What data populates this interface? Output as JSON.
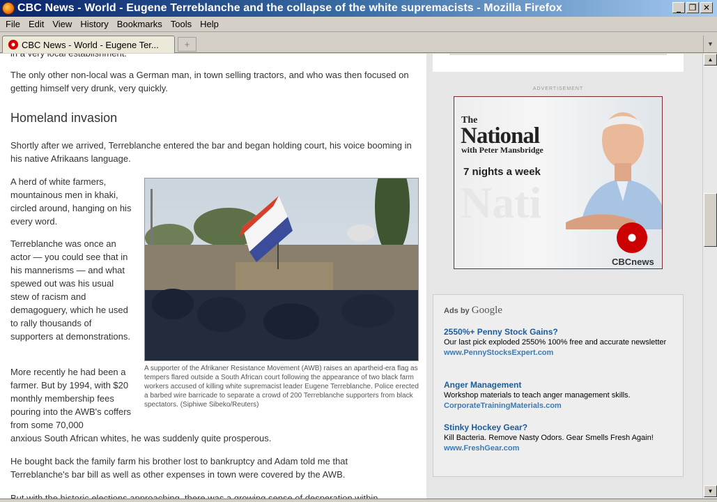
{
  "window": {
    "title": "CBC News - World - Eugene Terreblanche and the collapse of the white supremacists - Mozilla Firefox",
    "minimize": "_",
    "maximize": "❐",
    "close": "✕"
  },
  "menu": [
    "File",
    "Edit",
    "View",
    "History",
    "Bookmarks",
    "Tools",
    "Help"
  ],
  "tab": {
    "label": "CBC News - World - Eugene Ter...",
    "new_tab_icon": "+"
  },
  "article": {
    "cut_top": "in a very local establishment.",
    "p1": "The only other non-local was a German man, in town selling tractors, and who was then focused on getting himself very drunk, very quickly.",
    "subhead": "Homeland invasion",
    "p2": "Shortly after we arrived, Terreblanche entered the bar and began holding court, his voice booming in his native Afrikaans language.",
    "p3": "A herd of white farmers, mountainous men in khaki, circled around, hanging on his every word.",
    "p4": "Terreblanche was once an actor — you could see that in his mannerisms — and what spewed out was his usual stew of racism and demagoguery, which he used to rally thousands of supporters at demonstrations.",
    "p5a": "More recently he had been a farmer. But by 1994, with $20 monthly membership fees pouring into the AWB's coffers from some 70,000",
    "p5b": "anxious South African whites, he was suddenly quite prosperous.",
    "p6": "He bought back the family farm his brother lost to bankruptcy and Adam told me that Terreblanche's bar bill as well as other expenses in town were covered by the AWB.",
    "p7": "But with the historic elections approaching, there was a growing sense of desperation within",
    "photo_caption": "A supporter of the Afrikaner Resistance Movement (AWB) raises an apartheid-era flag as tempers flared outside a South African court following the appearance of two black farm workers accused of killing white supremacist leader Eugene Terreblanche. Police erected a barbed wire barricade to separate a crowd of 200 Terreblanche supporters from black spectators. (Siphiwe Sibeko/Reuters)"
  },
  "sidebar": {
    "ad_label": "ADVERTISEMENT",
    "banner": {
      "the": "The",
      "national": "National",
      "with": "with Peter Mansbridge",
      "nights": "7 nights a week",
      "ghost": "Nati",
      "cbcnews": "CBCnews"
    },
    "google": {
      "ads_by": "Ads by",
      "google_word": "Google",
      "ads": [
        {
          "title": "2550%+ Penny Stock Gains?",
          "desc": "Our last pick exploded 2550% 100% free and accurate newsletter",
          "url": "www.PennyStocksExpert.com"
        },
        {
          "title": "Anger Management",
          "desc": "Workshop materials to teach anger management skills.",
          "url": "CorporateTrainingMaterials.com"
        },
        {
          "title": "Stinky Hockey Gear?",
          "desc": "Kill Bacteria. Remove Nasty Odors. Gear Smells Fresh Again!",
          "url": "www.FreshGear.com"
        }
      ]
    }
  },
  "scrollbar": {
    "up": "▲",
    "down": "▼"
  }
}
